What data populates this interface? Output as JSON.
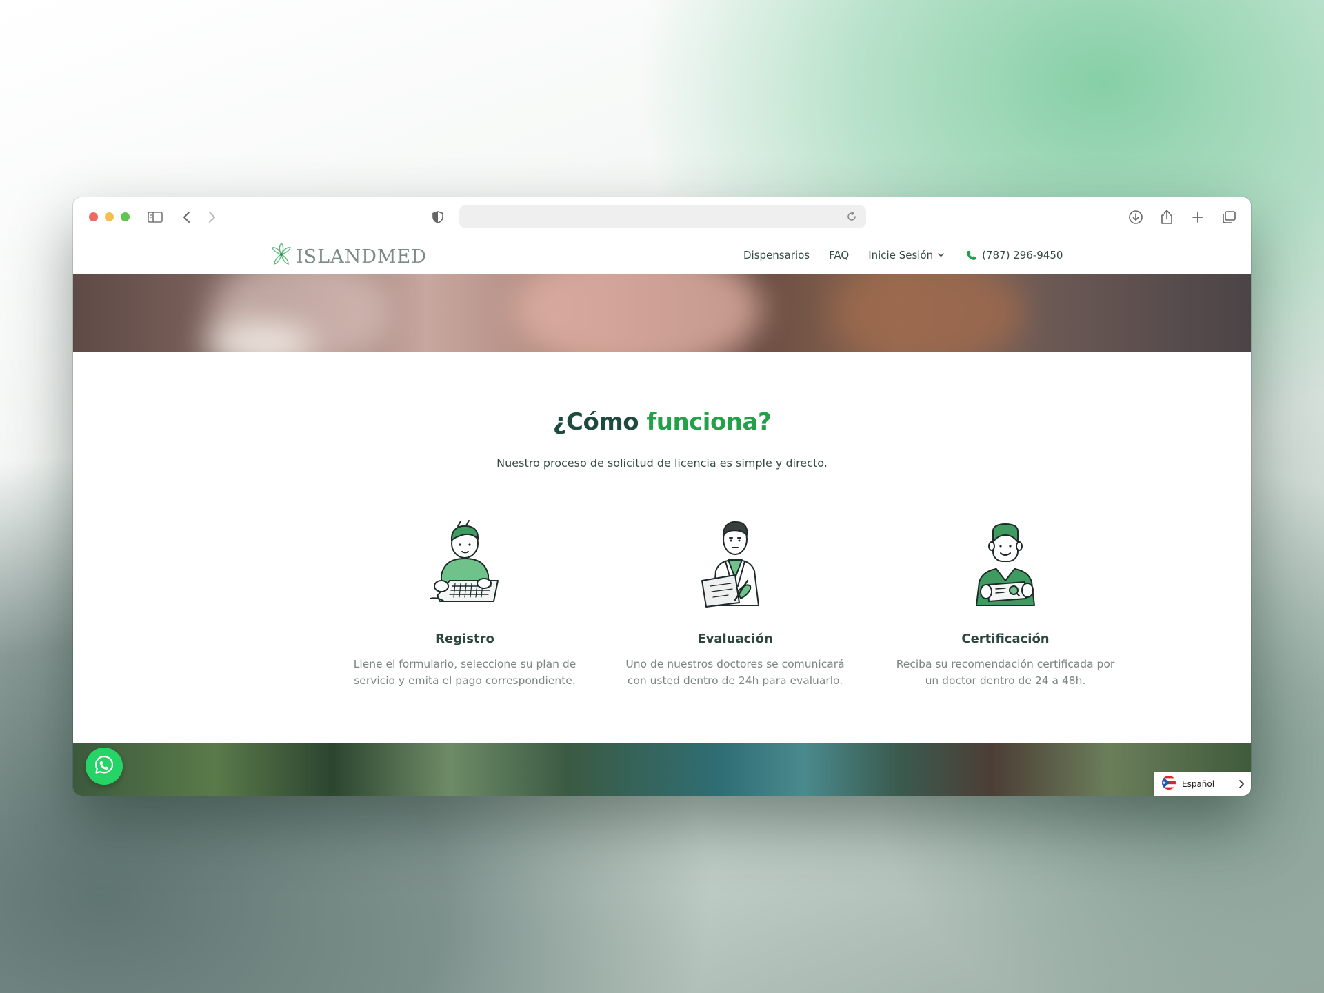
{
  "browser": {
    "address_value": ""
  },
  "nav": {
    "logo_text": "ISLANDMED",
    "links": [
      "Dispensarios",
      "FAQ",
      "Inicie Sesión"
    ],
    "phone": "(787) 296-9450"
  },
  "section": {
    "title_part1": "¿Cómo",
    "title_part2": "funciona?",
    "subtitle": "Nuestro proceso de solicitud de licencia es simple y directo."
  },
  "steps": [
    {
      "title": "Registro",
      "description": "Llene el formulario, seleccione su plan de servicio y emita el pago correspondiente."
    },
    {
      "title": "Evaluación",
      "description": "Uno de nuestros doctores se comunicará con usted dentro de 24h para evaluarlo."
    },
    {
      "title": "Certificación",
      "description": "Reciba su recomendación certificada por un doctor dentro de 24 a 48h."
    }
  ],
  "language": {
    "label": "Español"
  },
  "colors": {
    "accent_green": "#23a14a",
    "heading_dark": "#1f4a3f",
    "whatsapp": "#25d366"
  }
}
